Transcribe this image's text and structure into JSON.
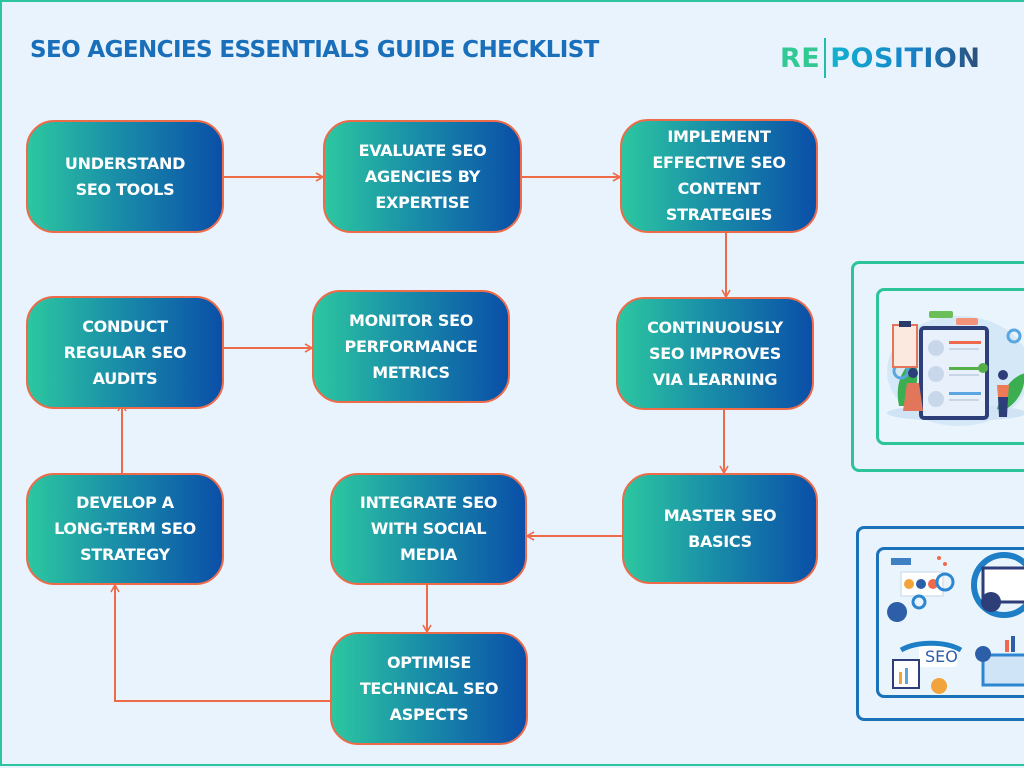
{
  "title": "SEO AGENCIES ESSENTIALS GUIDE CHECKLIST",
  "logo": {
    "part1": "RE",
    "part2": "POSITION"
  },
  "colors": {
    "title": "#1a6fba",
    "node_border": "#ee6b4a",
    "node_gradient_start": "#2cc7a0",
    "node_gradient_end": "#0a4fa8",
    "arrow": "#ee6b4a",
    "frame": "#2ec4a0",
    "background": "#e8f3fd"
  },
  "nodes": [
    {
      "id": "understand",
      "lines": [
        "UNDERSTAND",
        "SEO TOOLS"
      ]
    },
    {
      "id": "evaluate",
      "lines": [
        "EVALUATE SEO",
        "AGENCIES BY",
        "EXPERTISE"
      ]
    },
    {
      "id": "implement",
      "lines": [
        "IMPLEMENT",
        "EFFECTIVE SEO",
        "CONTENT",
        "STRATEGIES"
      ]
    },
    {
      "id": "continuously",
      "lines": [
        "CONTINUOUSLY",
        "SEO IMPROVES",
        "VIA LEARNING"
      ]
    },
    {
      "id": "master",
      "lines": [
        "MASTER SEO",
        "BASICS"
      ]
    },
    {
      "id": "integrate",
      "lines": [
        "INTEGRATE SEO",
        "WITH SOCIAL",
        "MEDIA"
      ]
    },
    {
      "id": "optimise",
      "lines": [
        "OPTIMISE",
        "TECHNICAL SEO",
        "ASPECTS"
      ]
    },
    {
      "id": "develop",
      "lines": [
        "DEVELOP A",
        "LONG-TERM SEO",
        "STRATEGY"
      ]
    },
    {
      "id": "conduct",
      "lines": [
        "CONDUCT",
        "REGULAR SEO",
        "AUDITS"
      ]
    },
    {
      "id": "monitor",
      "lines": [
        "MONITOR SEO",
        "PERFORMANCE",
        "METRICS"
      ]
    }
  ],
  "edges": [
    [
      "understand",
      "evaluate"
    ],
    [
      "evaluate",
      "implement"
    ],
    [
      "implement",
      "continuously"
    ],
    [
      "continuously",
      "master"
    ],
    [
      "master",
      "integrate"
    ],
    [
      "integrate",
      "optimise"
    ],
    [
      "optimise",
      "develop"
    ],
    [
      "develop",
      "conduct"
    ],
    [
      "conduct",
      "monitor"
    ]
  ],
  "illustrations": [
    {
      "name": "team-review-illustration",
      "subject": "two people reviewing profile checklist board"
    },
    {
      "name": "seo-analytics-illustration",
      "subject": "SEO analytics icons collage",
      "text": "SEO"
    }
  ]
}
